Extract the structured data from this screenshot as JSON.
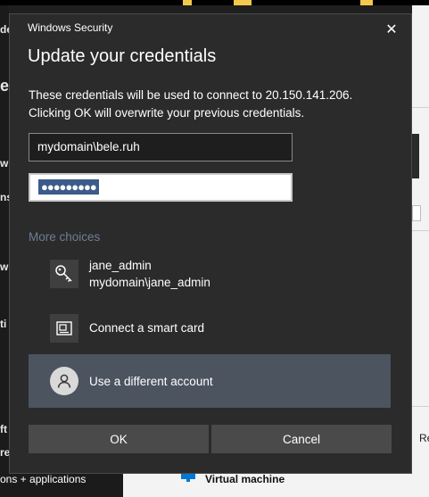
{
  "dialog": {
    "caption": "Windows Security",
    "title": "Update your credentials",
    "message_line1": "These credentials will be used to connect to 20.150.141.206.",
    "message_line2": "Clicking OK will overwrite your previous credentials.",
    "username_value": "mydomain\\bele.ruh",
    "password_mask": "●●●●●●●●●",
    "more_choices_label": "More choices",
    "choices": [
      {
        "line1": "jane_admin",
        "line2": "mydomain\\jane_admin",
        "icon": "key-icon"
      },
      {
        "line1": "Connect a smart card",
        "icon": "smart-card-icon"
      },
      {
        "line1": "Use a different account",
        "icon": "user-icon",
        "selected": true
      }
    ],
    "ok_label": "OK",
    "cancel_label": "Cancel",
    "close_glyph": "✕"
  },
  "background": {
    "left_fragments": [
      "de",
      "e",
      "ns",
      "w",
      "ns",
      "w",
      "ti",
      "ft",
      "re"
    ],
    "right_fragments": [
      "Re"
    ],
    "bottom_left_text": "ons + applications",
    "bottom_vm_label": "Virtual machine",
    "accent_color": "#0078d4"
  }
}
